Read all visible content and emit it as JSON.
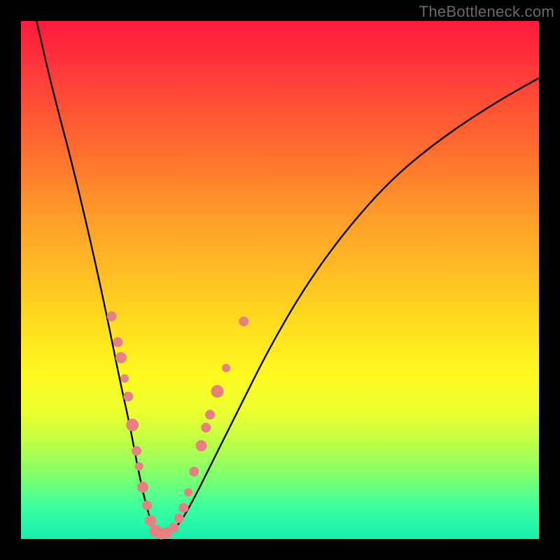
{
  "watermark": "TheBottleneck.com",
  "chart_data": {
    "type": "line",
    "title": "",
    "xlabel": "",
    "ylabel": "",
    "xlim": [
      0,
      100
    ],
    "ylim": [
      0,
      100
    ],
    "series": [
      {
        "name": "curve",
        "x": [
          3,
          6,
          10,
          14,
          17,
          19,
          21,
          22.5,
          24,
          25.5,
          27,
          30,
          33,
          37,
          42,
          48,
          55,
          63,
          72,
          82,
          92,
          100
        ],
        "y": [
          100,
          87,
          72,
          55,
          41,
          31,
          22,
          14,
          7,
          2,
          0.5,
          2,
          7,
          15,
          25,
          37,
          49,
          60,
          70,
          78,
          84.5,
          89
        ]
      }
    ],
    "markers": [
      {
        "x": 17.5,
        "y": 43,
        "r": 7
      },
      {
        "x": 18.7,
        "y": 38,
        "r": 7
      },
      {
        "x": 19.3,
        "y": 35,
        "r": 8
      },
      {
        "x": 20.0,
        "y": 31,
        "r": 6
      },
      {
        "x": 20.7,
        "y": 27.5,
        "r": 7
      },
      {
        "x": 21.5,
        "y": 22,
        "r": 9
      },
      {
        "x": 22.3,
        "y": 17,
        "r": 7
      },
      {
        "x": 22.8,
        "y": 14,
        "r": 6
      },
      {
        "x": 23.5,
        "y": 10,
        "r": 8
      },
      {
        "x": 24.3,
        "y": 6.5,
        "r": 7
      },
      {
        "x": 25.0,
        "y": 3.5,
        "r": 8
      },
      {
        "x": 26.0,
        "y": 1.5,
        "r": 9
      },
      {
        "x": 27.0,
        "y": 1.0,
        "r": 8
      },
      {
        "x": 28.2,
        "y": 1.2,
        "r": 8
      },
      {
        "x": 29.5,
        "y": 2.2,
        "r": 7
      },
      {
        "x": 30.5,
        "y": 4,
        "r": 7
      },
      {
        "x": 31.4,
        "y": 6,
        "r": 7
      },
      {
        "x": 32.3,
        "y": 9,
        "r": 6
      },
      {
        "x": 33.4,
        "y": 13,
        "r": 7
      },
      {
        "x": 34.8,
        "y": 18,
        "r": 8
      },
      {
        "x": 35.7,
        "y": 21.5,
        "r": 7
      },
      {
        "x": 36.5,
        "y": 24,
        "r": 7
      },
      {
        "x": 37.9,
        "y": 28.5,
        "r": 9
      },
      {
        "x": 39.6,
        "y": 33,
        "r": 6
      },
      {
        "x": 43.0,
        "y": 42,
        "r": 7
      }
    ],
    "colors": {
      "curve": "#000000",
      "marker_fill": "#e78080",
      "marker_stroke": "#d86c6c"
    }
  }
}
